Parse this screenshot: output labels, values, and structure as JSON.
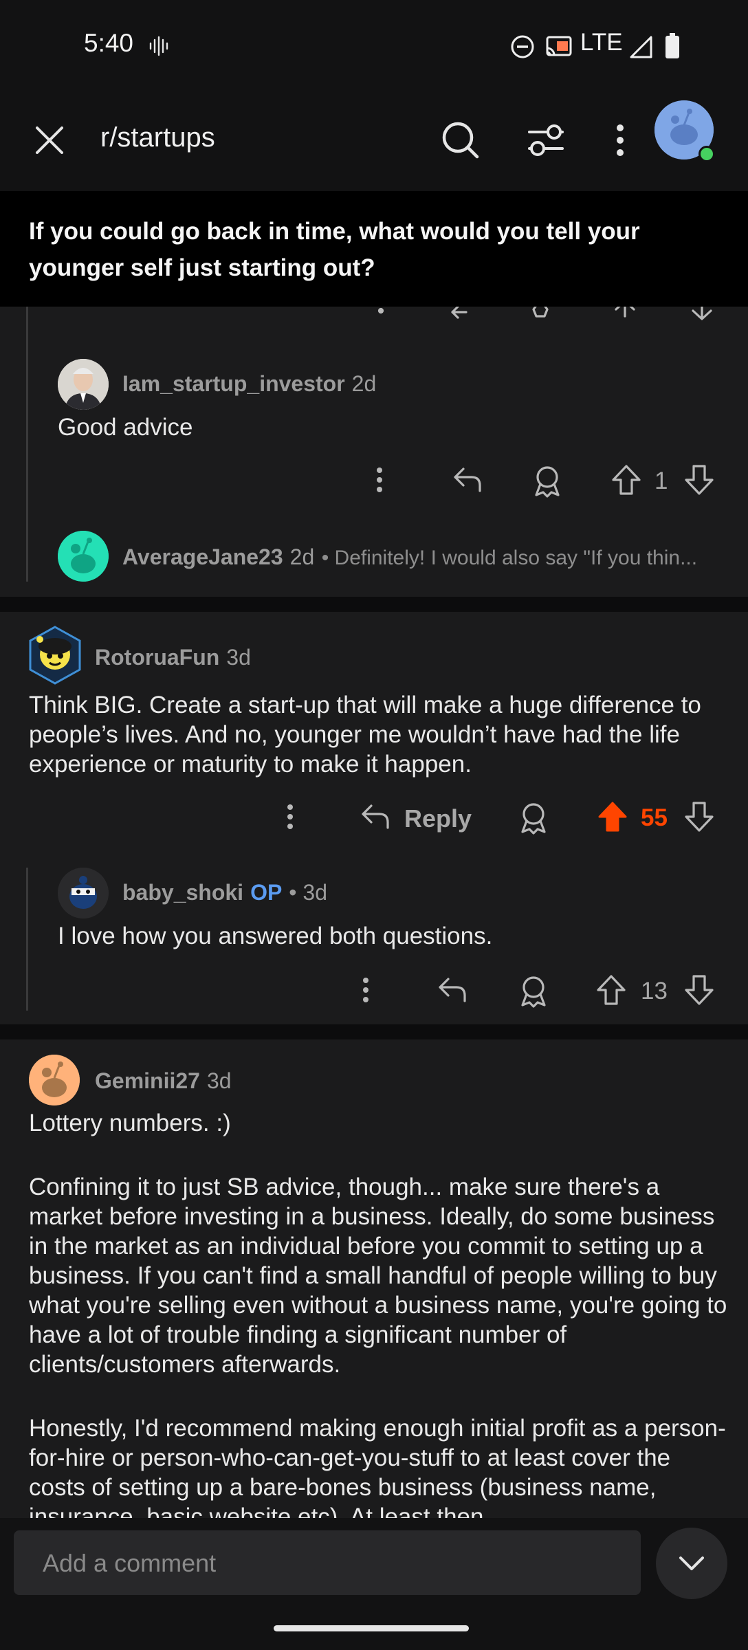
{
  "status_bar": {
    "time": "5:40",
    "network": "LTE"
  },
  "header": {
    "subreddit": "r/startups"
  },
  "post": {
    "title": "If you could go back in time, what would you tell your younger self just starting out?"
  },
  "comments": [
    {
      "user": "Iam_startup_investor",
      "age": "2d",
      "body": "Good advice",
      "votes": "1"
    },
    {
      "user": "AverageJane23",
      "age": "2d",
      "preview": "• Definitely! I would also say \"If you thin..."
    },
    {
      "user": "RotoruaFun",
      "age": "3d",
      "body": "Think BIG. Create a start-up that will make a huge difference to people’s lives. And no, younger me wouldn’t have had the life experience or maturity to make it happen.",
      "reply_label": "Reply",
      "votes": "55"
    },
    {
      "user": "baby_shoki",
      "op_badge": "OP",
      "age": "• 3d",
      "body": "I love how you answered both questions.",
      "votes": "13"
    },
    {
      "user": "Geminii27",
      "age": "3d",
      "body_p1": "Lottery numbers. :)",
      "body_p2": "Confining it to just SB advice, though... make sure there's a market before investing in a business. Ideally, do some business in the market as an individual before you commit to setting up a business. If you can't find a small handful of people willing to buy what you're selling even without a business name, you're going to have a lot of trouble finding a significant number of clients/customers afterwards.",
      "body_p3": "Honestly, I'd recommend making enough initial profit as a person-for-hire or person-who-can-get-you-stuff to at least cover the costs of setting up a bare-bones business (business name, insurance, basic website etc). At least then"
    }
  ],
  "composer": {
    "placeholder": "Add a comment"
  },
  "colors": {
    "upvote_active": "#ff4500",
    "op_badge": "#5b9cf2",
    "background": "#121213",
    "card": "#1b1b1c"
  }
}
